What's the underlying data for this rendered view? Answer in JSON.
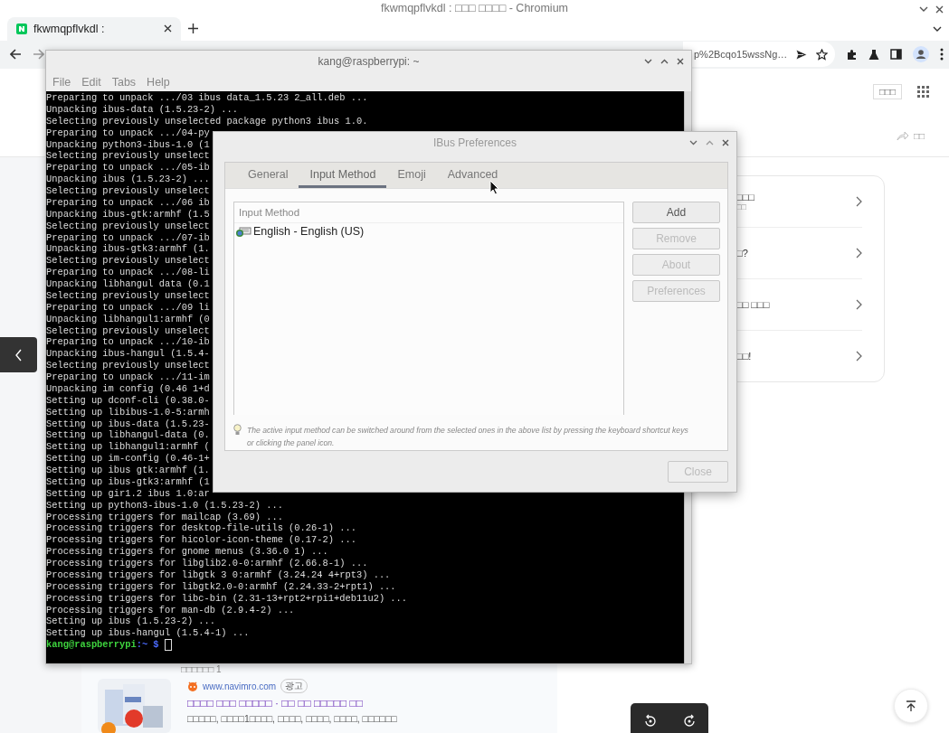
{
  "browser": {
    "window_title": "fkwmqpflvkdl : □□□ □□□□ - Chromium",
    "tabs": [
      {
        "title": "fkwmqpflvkdl :",
        "selected": true
      }
    ],
    "address": "p%2Bcqo15wssNg…"
  },
  "page": {
    "header_button": "□□□",
    "share": "□□",
    "card_items": [
      {
        "title": "□□□",
        "subtitle": "□□"
      },
      {
        "title": "□?"
      },
      {
        "title": "□□ □□□"
      },
      {
        "title": "□□!"
      }
    ],
    "result_meta": "□□□□□□ 1",
    "ad": {
      "site": "www.navimro.com",
      "badge": "광고",
      "title": "□□□□ □□□ □□□□□ · □□ □□ □□□□□ □□",
      "description": "□□□□□, □□□□1□□□□, □□□□, □□□□, □□□□, □□□□□□"
    }
  },
  "terminal": {
    "title": "kang@raspberrypi: ~",
    "menu": [
      "File",
      "Edit",
      "Tabs",
      "Help"
    ],
    "lines": [
      "Preparing to unpack .../03 ibus data_1.5.23 2_all.deb ...",
      "Unpacking ibus-data (1.5.23-2) ...",
      "Selecting previously unselected package python3 ibus 1.0.",
      "Preparing to unpack .../04-py",
      "Unpacking python3-ibus-1.0 (1",
      "Selecting previously unselect",
      "Preparing to unpack .../05-ib",
      "Unpacking ibus (1.5.23-2) ...",
      "Selecting previously unselect",
      "Preparing to unpack .../06 ib",
      "Unpacking ibus-gtk:armhf (1.5",
      "Selecting previously unselect",
      "Preparing to unpack .../07-ib",
      "Unpacking ibus-gtk3:armhf (1.",
      "Selecting previously unselect",
      "Preparing to unpack .../08-li",
      "Unpacking libhangul data (0.1",
      "Selecting previously unselect",
      "Preparing to unpack .../09 li",
      "Unpacking libhangul1:armhf (0",
      "Selecting previously unselect",
      "Preparing to unpack .../10-ib",
      "Unpacking ibus-hangul (1.5.4-",
      "Selecting previously unselect",
      "Preparing to unpack .../11-im",
      "Unpacking im config (0.46 1+d",
      "Setting up dconf-cli (0.38.0-",
      "Setting up libibus-1.0-5:armh",
      "Setting up ibus-data (1.5.23-",
      "Setting up libhangul-data (0.",
      "Setting up libhangul1:armhf (",
      "Setting up im-config (0.46-1+",
      "Setting up ibus gtk:armhf (1.",
      "Setting up ibus-gtk3:armhf (1",
      "Setting up gir1.2 ibus 1.0:ar",
      "Setting up python3-ibus-1.0 (1.5.23-2) ...",
      "Processing triggers for mailcap (3.69) ...",
      "Processing triggers for desktop-file-utils (0.26-1) ...",
      "Processing triggers for hicolor-icon-theme (0.17-2) ...",
      "Processing triggers for gnome menus (3.36.0 1) ...",
      "Processing triggers for libglib2.0-0:armhf (2.66.8-1) ...",
      "Processing triggers for libgtk 3 0:armhf (3.24.24 4+rpt3) ...",
      "Processing triggers for libgtk2.0-0:armhf (2.24.33-2+rpt1) ...",
      "Processing triggers for libc-bin (2.31-13+rpt2+rpi1+deb11u2) ...",
      "Processing triggers for man-db (2.9.4-2) ...",
      "Setting up ibus (1.5.23-2) ...",
      "Setting up ibus-hangul (1.5.4-1) ..."
    ],
    "prompt": {
      "user_host": "kang@raspberrypi",
      "path": ":~",
      "symbol": "$"
    }
  },
  "ibus_dialog": {
    "title": "IBus Preferences",
    "tabs": [
      {
        "label": "General",
        "selected": false
      },
      {
        "label": "Input Method",
        "selected": true
      },
      {
        "label": "Emoji",
        "selected": false
      },
      {
        "label": "Advanced",
        "selected": false
      }
    ],
    "list_header": "Input Method",
    "methods": [
      {
        "name": "English - English (US)"
      }
    ],
    "buttons": [
      {
        "label": "Add",
        "disabled": false
      },
      {
        "label": "Remove",
        "disabled": true
      },
      {
        "label": "About",
        "disabled": true
      },
      {
        "label": "Preferences",
        "disabled": true
      }
    ],
    "hint": "The active input method can be switched around from the selected ones in the above list by pressing the keyboard shortcut keys or clicking the panel icon.",
    "close": {
      "label": "Close",
      "disabled": true
    }
  }
}
